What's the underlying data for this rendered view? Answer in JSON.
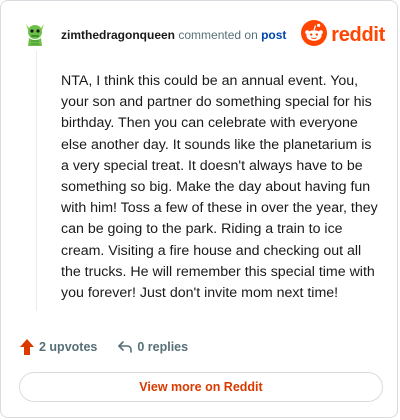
{
  "comment": {
    "author": "zimthedragonqueen",
    "action_text": "commented on",
    "post_link_text": "post",
    "body": "NTA, I think this could be an annual event. You, your son and partner do something special for his birthday. Then you can celebrate with everyone else another day. It sounds like the planetarium is a very special treat. It doesn't always have to be something so big. Make the day about having fun with him! Toss a few of these in over the year, they can be going to the park. Riding a train to ice cream. Visiting a fire house and checking out all the trucks. He will remember this special time with you forever! Just don't invite mom next time!",
    "upvotes_label": "2 upvotes",
    "replies_label": "0 replies"
  },
  "brand": {
    "wordmark": "reddit",
    "icon": "reddit-snoo-icon",
    "accent_color": "#ff4500"
  },
  "footer": {
    "view_more_label": "View more on Reddit"
  },
  "icons": {
    "avatar": "dragon-avatar-icon",
    "upvote": "upvote-arrow-icon",
    "reply": "reply-arrow-icon"
  }
}
